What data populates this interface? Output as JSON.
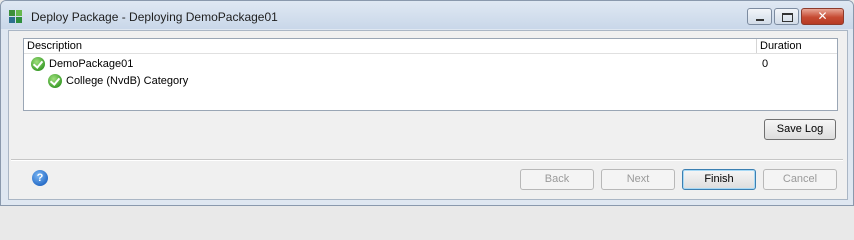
{
  "window": {
    "title": "Deploy Package - Deploying DemoPackage01"
  },
  "table": {
    "columns": [
      "Description",
      "Duration"
    ],
    "rows": [
      {
        "description": "DemoPackage01",
        "duration": "0",
        "status_icon": "check-circle-icon"
      },
      {
        "description": "College (NvdB) Category",
        "duration": "",
        "status_icon": "check-circle-icon"
      }
    ]
  },
  "buttons": {
    "save_log": "Save Log",
    "back": "Back",
    "next": "Next",
    "finish": "Finish",
    "cancel": "Cancel",
    "help_icon": "?"
  },
  "colors": {
    "success": "#3f9f2d",
    "help": "#2a6fc9",
    "close": "#c64b33"
  }
}
